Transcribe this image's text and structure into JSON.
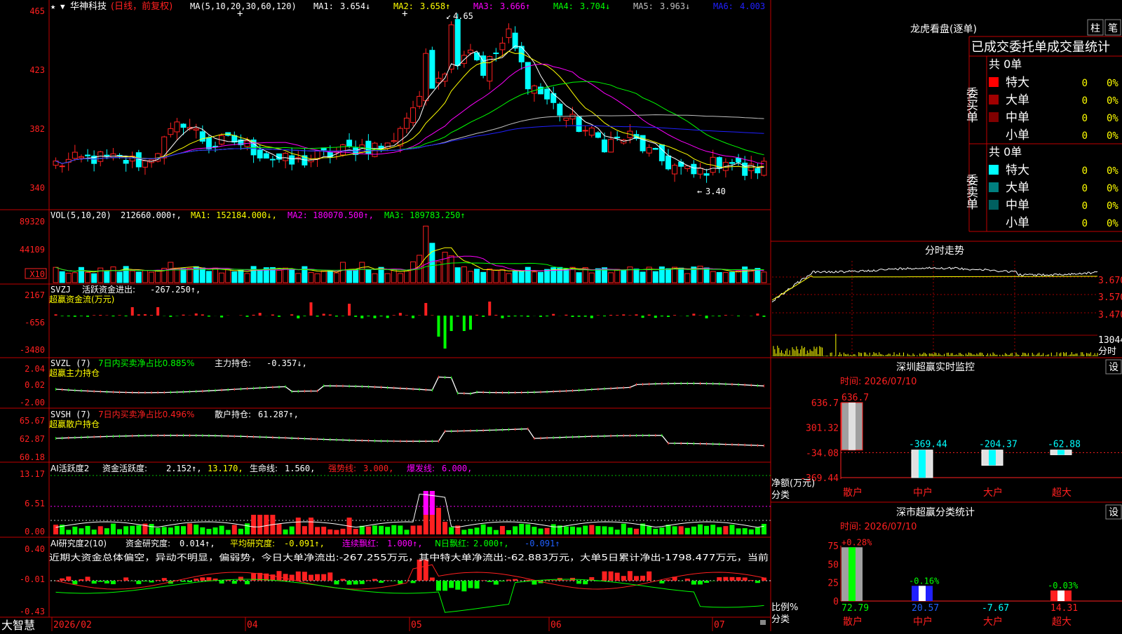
{
  "colors": {
    "up": "#ff2020",
    "down": "#00ffff",
    "green": "#00ff00",
    "grid": "#ff0000",
    "border": "#c00000",
    "yellow": "#ffff00",
    "magenta": "#ff00ff",
    "white": "#ffffff",
    "blue": "#2020ff",
    "gray": "#c0c0c0"
  },
  "main": {
    "star": "★",
    "pin": "▼",
    "stock_name": "华神科技",
    "period": "(日线，前复权)",
    "ma_params": "MA(5,10,20,30,60,120)",
    "mas": [
      {
        "label": "MA1:",
        "value": "3.654↓",
        "color": "#ffffff"
      },
      {
        "label": "MA2:",
        "value": "3.658↑",
        "color": "#ffff00"
      },
      {
        "label": "MA3:",
        "value": "3.666↑",
        "color": "#ff00ff"
      },
      {
        "label": "MA4:",
        "value": "3.704↓",
        "color": "#00ff00"
      },
      {
        "label": "MA5:",
        "value": "3.963↓",
        "color": "#c0c0c0"
      },
      {
        "label": "MA6:",
        "value": "4.003",
        "color": "#2020ff"
      }
    ],
    "ylabels": [
      "465",
      "423",
      "382",
      "340"
    ],
    "high_note": "4.65",
    "low_note": "3.40"
  },
  "vol": {
    "name": "VOL(5,10,20)",
    "value": "212660.000↑,",
    "ma1": "MA1: 152184.000↓,",
    "ma2": "MA2: 180070.500↑,",
    "ma3": "MA3: 189783.250↑",
    "ylabels": [
      "89320",
      "44109"
    ],
    "unit": "X10"
  },
  "svzj": {
    "name": "SVZJ",
    "title": "活跃资金进出:",
    "value": "-267.250↑,",
    "subtitle": "超赢资金流(万元)",
    "ylabels": [
      "2167",
      "-656",
      "-3480"
    ]
  },
  "svzl": {
    "name": "SVZL (7)",
    "title": "7日内买卖净占比0.885%",
    "hold_label": "主力持仓:",
    "hold_value": "-0.357↓,",
    "subtitle": "超赢主力持仓",
    "ylabels": [
      "2.04",
      "0.02",
      "-2.00"
    ]
  },
  "svsh": {
    "name": "SVSH (7)",
    "title": "7日内买卖净占比0.496%",
    "hold_label": "散户持仓:",
    "hold_value": "61.287↑,",
    "subtitle": "超赢散户持仓",
    "ylabels": [
      "65.67",
      "62.87",
      "60.18"
    ]
  },
  "ai1": {
    "name": "AI活跃度2",
    "t1": "资金活跃度:",
    "v1": "2.152↑,",
    "v2": "13.170,",
    "t3": "生命线:",
    "v3": "1.560,",
    "t4": "强势线:",
    "v4": "3.000,",
    "t5": "爆发线:",
    "v5": "6.000,",
    "ylabels": [
      "13.17",
      "6.51",
      "0.00"
    ]
  },
  "ai2": {
    "name": "AI研究度2(10)",
    "t1": "资金研究度:",
    "v1": "0.014↑,",
    "t2": "平均研究度:",
    "v2": "-0.091↑,",
    "t3": "连续飘红:",
    "v3": "1.000↑,",
    "t4": "N日飘红:",
    "v4": "2.000↑,",
    "v5": "-0.091↑",
    "comment": "近期大资金总体偏空，异动不明显，偏弱势，今日大单净流出:-267.255万元，其中特大单净流出:-62.883万元，大单5日累计净出-1798.477万元，当前",
    "ylabels": [
      "0.40",
      "-0.01",
      "-0.43"
    ]
  },
  "bottom": {
    "brand": "大智慧",
    "dates": [
      "2026/02",
      "04",
      "05",
      "06",
      "07"
    ]
  },
  "lhb": {
    "title": "龙虎看盘(逐单)",
    "btn1": "柱",
    "btn2": "笔",
    "stats_title": "已成交委托单成交量统计",
    "buy_side": "委买单",
    "sell_side": "委卖单",
    "buy_total": "共 0单",
    "sell_total": "共 0单",
    "buy_rows": [
      {
        "name": "特大",
        "count": "0",
        "pct": "0%",
        "color": "#ff0000"
      },
      {
        "name": "大单",
        "count": "0",
        "pct": "0%",
        "color": "#a00000"
      },
      {
        "name": "中单",
        "count": "0",
        "pct": "0%",
        "color": "#800000"
      },
      {
        "name": "小单",
        "count": "0",
        "pct": "0%",
        "color": ""
      }
    ],
    "sell_rows": [
      {
        "name": "特大",
        "count": "0",
        "pct": "0%",
        "color": "#00ffff"
      },
      {
        "name": "大单",
        "count": "0",
        "pct": "0%",
        "color": "#008080"
      },
      {
        "name": "中单",
        "count": "0",
        "pct": "0%",
        "color": "#006060"
      },
      {
        "name": "小单",
        "count": "0",
        "pct": "0%",
        "color": ""
      }
    ]
  },
  "intraday": {
    "title": "分时走势",
    "ylabels": [
      "3.670",
      "3.570",
      "3.470"
    ],
    "vol_label": "13044",
    "footer": "分时"
  },
  "monitor": {
    "title": "深圳超赢实时监控",
    "btn": "设",
    "time": "时间: 2026/07/10",
    "ylabels": [
      "636.7",
      "301.32",
      "-34.08",
      "-369.44"
    ],
    "ytitle": "净额(万元)",
    "xtitle": "分类"
  },
  "classify": {
    "title": "深市超赢分类统计",
    "btn": "设",
    "time": "时间: 2026/07/10",
    "ylabels": [
      "75",
      "50",
      "25",
      "0"
    ],
    "ytitle": "比例%",
    "xtitle": "分类"
  },
  "chart_data": [
    {
      "type": "bar",
      "title": "深圳超赢实时监控",
      "xlabel": "分类",
      "ylabel": "净额(万元)",
      "categories": [
        "散户",
        "中户",
        "大户",
        "超大"
      ],
      "values": [
        636.7,
        -369.44,
        -204.37,
        -62.88
      ],
      "value_labels": [
        "636.7",
        "-369.44",
        "-204.37",
        "-62.88"
      ],
      "ylim": [
        -369.44,
        636.7
      ]
    },
    {
      "type": "bar",
      "title": "深市超赢分类统计",
      "xlabel": "分类",
      "ylabel": "比例%",
      "categories": [
        "散户",
        "中户",
        "大户",
        "超大"
      ],
      "values": [
        72.79,
        20.57,
        -7.67,
        14.31
      ],
      "value_labels": [
        "72.79",
        "20.57",
        "-7.67",
        "14.31"
      ],
      "change_labels": [
        "+0.28%",
        "-0.16%",
        "",
        "-0.03%"
      ],
      "ylim": [
        0,
        75
      ]
    }
  ]
}
